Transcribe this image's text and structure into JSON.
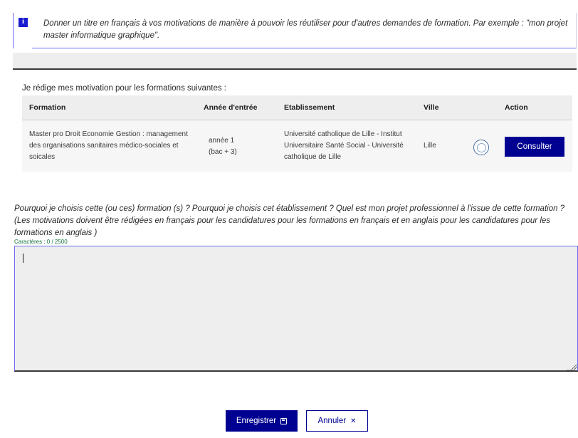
{
  "info": {
    "text": "Donner un titre en français à vos motivations de manière à pouvoir les réutiliser pour d'autres demandes de formation. Par exemple : \"mon projet master informatique graphique\"."
  },
  "title_input": {
    "value": ""
  },
  "table": {
    "intro": "Je rédige mes motivation pour les formations suivantes :",
    "headers": {
      "formation": "Formation",
      "annee": "Année d'entrée",
      "etablissement": "Etablissement",
      "ville": "Ville",
      "action": "Action"
    },
    "rows": [
      {
        "formation": "Master pro Droit Economie Gestion : management des organisations sanitaires médico-sociales et soicales",
        "annee_line1": "année 1",
        "annee_line2": "(bac + 3)",
        "etablissement": "Université catholique de Lille - Institut Universitaire Santé Social - Université catholique de Lille",
        "ville": "Lille",
        "logo_icon": "university-seal-icon",
        "action_label": "Consulter"
      }
    ]
  },
  "motivation": {
    "label": "Pourquoi je choisis cette (ou ces) formation (s) ? Pourquoi je choisis cet établissement ? Quel est mon projet professionnel à l'issue de cette formation ? (Les motivations doivent être rédigées en français pour les candidatures pour les formations en français et en anglais pour les candidatures pour les formations en anglais )",
    "char_count": "Caractères : 0 / 2500",
    "value": ""
  },
  "buttons": {
    "save_label": "Enregistrer",
    "save_icon": "save-icon",
    "cancel_label": "Annuler",
    "cancel_icon": "close-icon"
  },
  "colors": {
    "primary": "#000091",
    "info_accent": "#6a6af4",
    "counter_green": "#18753c"
  }
}
